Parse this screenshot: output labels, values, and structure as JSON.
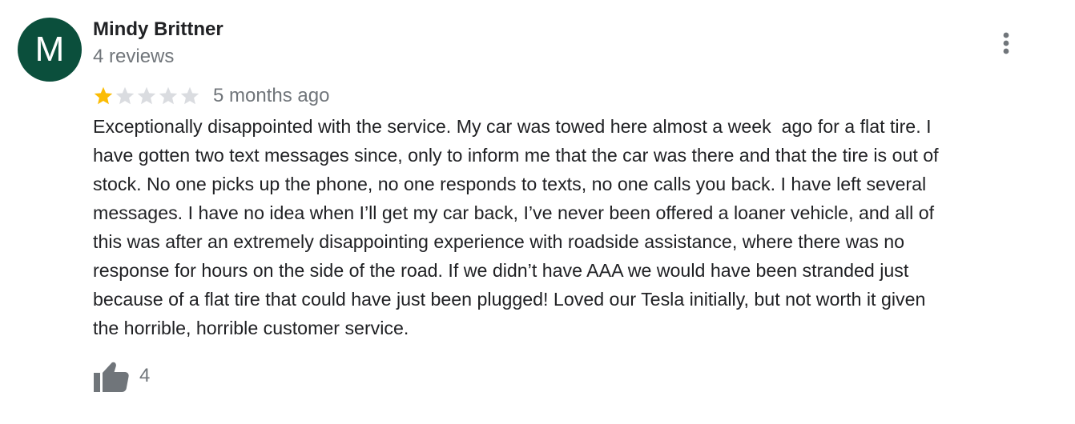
{
  "review": {
    "avatar_letter": "M",
    "avatar_color": "#0b4f3c",
    "author_name": "Mindy Brittner",
    "author_reviews": "4 reviews",
    "menu_icon": "more-vert-icon",
    "rating": 1,
    "rating_max": 5,
    "star_filled_color": "#fbbc04",
    "star_empty_color": "#dadce0",
    "time_ago": "5 months ago",
    "text_lines": [
      "Exceptionally disappointed with the service. My car was towed here almost a week  ago for a flat tire. I",
      "have gotten two text messages since, only to inform me that the car was there and that the tire is out of",
      "stock. No one picks up the phone, no one responds to texts, no one calls you back. I have left several",
      "messages. I have no idea when I’ll get my car back, I’ve never been offered a loaner vehicle, and all of",
      "this was after an extremely disappointing experience with roadside assistance, where there was no",
      "response for hours on the side of the road. If we didn’t have AAA we would have been stranded just",
      "because of a flat tire that could have just been plugged! Loved our Tesla initially, but not worth it given",
      "the horrible, horrible customer service."
    ],
    "like_icon": "thumb-up-icon",
    "like_count": "4"
  }
}
